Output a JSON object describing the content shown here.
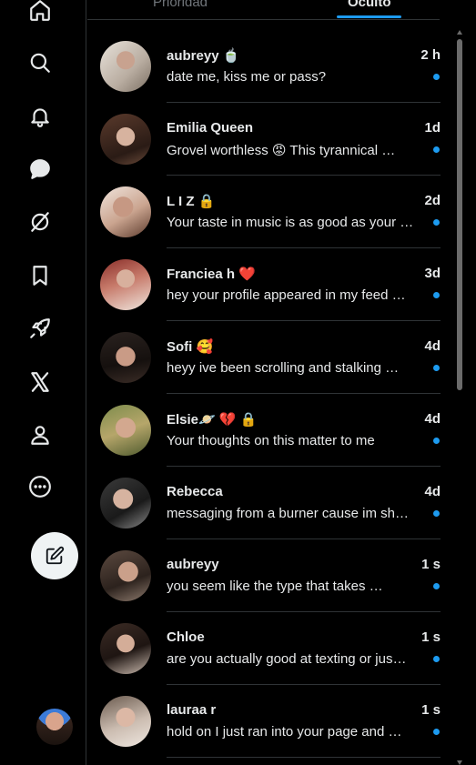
{
  "tabs": {
    "priority_label": "Prioridad",
    "hidden_label": "Oculto"
  },
  "colors": {
    "accent": "#1d9bf0",
    "background": "#000000",
    "text": "#e7e9ea",
    "muted": "#71767b",
    "divider": "#2f3336"
  },
  "nav": [
    {
      "icon": "home-icon"
    },
    {
      "icon": "search-icon"
    },
    {
      "icon": "bell-icon"
    },
    {
      "icon": "message-icon"
    },
    {
      "icon": "grok-icon"
    },
    {
      "icon": "bookmark-icon"
    },
    {
      "icon": "rocket-icon"
    },
    {
      "icon": "x-logo-icon"
    },
    {
      "icon": "profile-icon"
    },
    {
      "icon": "more-icon"
    },
    {
      "icon": "compose-icon"
    }
  ],
  "messages": [
    {
      "name": "aubreyy 🍵",
      "time": "2 h",
      "preview": "date me, kiss me or pass?",
      "unread": true
    },
    {
      "name": "Emilia Queen",
      "time": "1d",
      "preview": "Grovel worthless 😡 This tyrannical …",
      "unread": true
    },
    {
      "name": "L I Z 🔒",
      "time": "2d",
      "preview": "Your taste in music is as good as your …",
      "unread": true
    },
    {
      "name": "Franciea h ❤️",
      "time": "3d",
      "preview": "hey your profile appeared in my feed …",
      "unread": true
    },
    {
      "name": "Sofi 🥰",
      "time": "4d",
      "preview": "heyy ive been scrolling and stalking …",
      "unread": true
    },
    {
      "name": "Elsie🪐 💔 🔒",
      "time": "4d",
      "preview": "Your thoughts on this matter to me",
      "unread": true
    },
    {
      "name": "Rebecca",
      "time": "4d",
      "preview": "messaging from a burner cause im sh…",
      "unread": true
    },
    {
      "name": "aubreyy",
      "time": "1 s",
      "preview": "you seem like the type that takes …",
      "unread": true
    },
    {
      "name": "Chloe",
      "time": "1 s",
      "preview": "are you actually good at texting or jus…",
      "unread": true
    },
    {
      "name": "lauraa r",
      "time": "1 s",
      "preview": "hold on I just ran into your page and …",
      "unread": true
    }
  ]
}
